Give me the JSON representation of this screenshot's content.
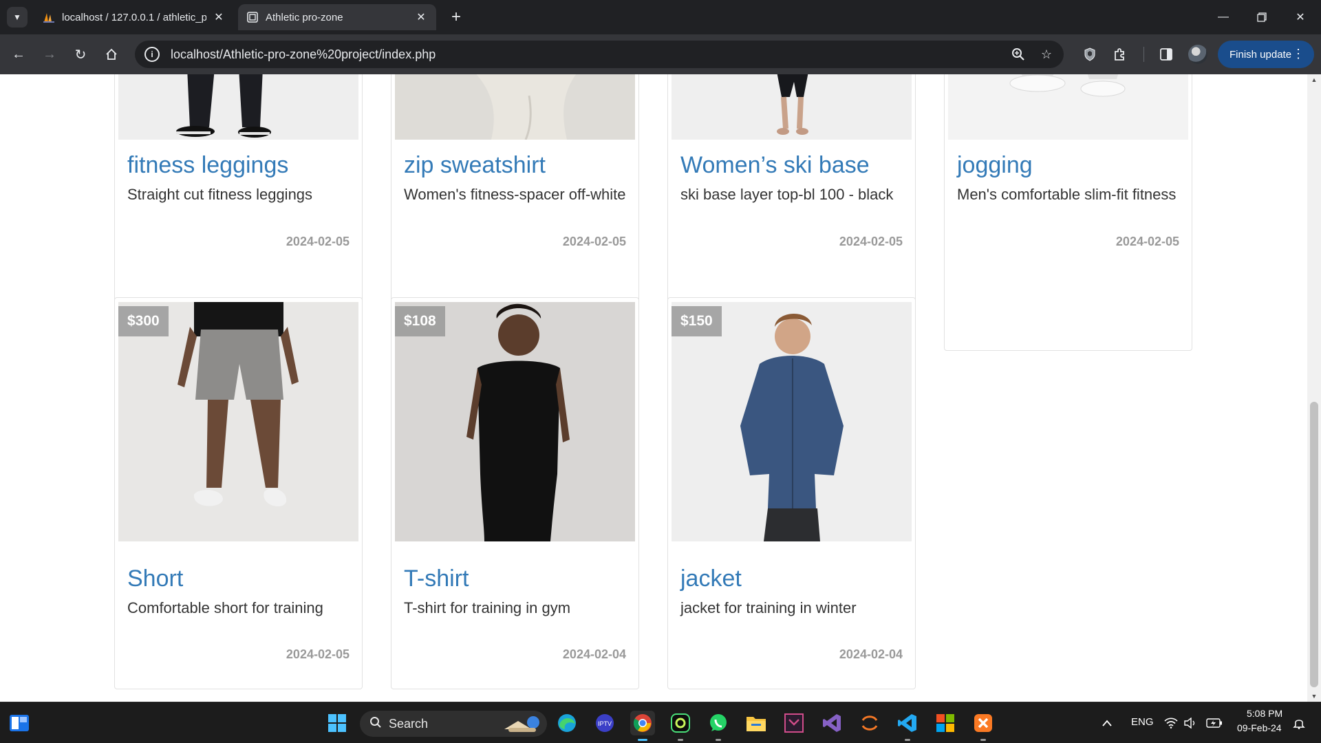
{
  "browser": {
    "tabs": [
      {
        "title": "localhost / 127.0.0.1 / athletic_p",
        "active": false,
        "favicon": "phpmyadmin-sail-icon"
      },
      {
        "title": "Athletic pro-zone",
        "active": true,
        "favicon": "page-document-icon"
      }
    ],
    "url": "localhost/Athletic-pro-zone%20project/index.php",
    "finish_update_label": "Finish update"
  },
  "products_top": [
    {
      "name": "fitness leggings",
      "description": "Straight cut fitness leggings",
      "date": "2024-02-05"
    },
    {
      "name": "zip sweatshirt",
      "description": "Women's fitness-spacer off-white",
      "date": "2024-02-05"
    },
    {
      "name": "Women’s ski base",
      "description": "ski base layer top-bl 100 - black",
      "date": "2024-02-05"
    },
    {
      "name": "jogging",
      "description": "Men's comfortable slim-fit fitness",
      "date": "2024-02-05"
    }
  ],
  "products_bottom": [
    {
      "price": "$300",
      "name": "Short",
      "description": "Comfortable short for training",
      "date": "2024-02-05"
    },
    {
      "price": "$108",
      "name": "T-shirt",
      "description": "T-shirt for training in gym",
      "date": "2024-02-04"
    },
    {
      "price": "$150",
      "name": "jacket",
      "description": "jacket for training in winter",
      "date": "2024-02-04"
    }
  ],
  "taskbar": {
    "search_label": "Search",
    "language": "ENG",
    "time": "5:08 PM",
    "date": "09-Feb-24"
  },
  "colors": {
    "link_blue": "#337ab7",
    "date_gray": "#999999",
    "price_badge": "#969696",
    "finish_update_bg": "#1a4d8c"
  }
}
